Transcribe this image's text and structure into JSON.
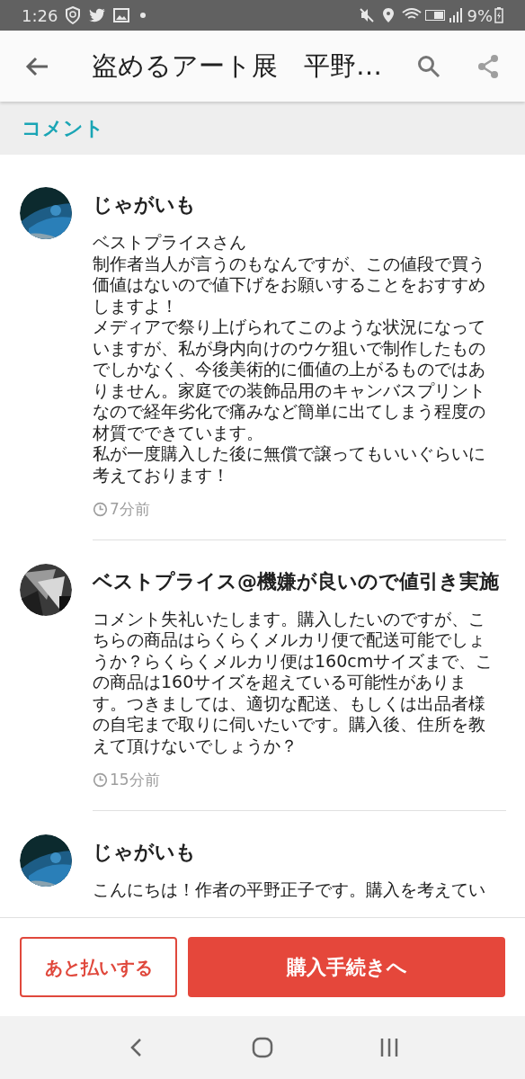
{
  "status_bar": {
    "time": "1:26",
    "battery": "9%"
  },
  "app_bar": {
    "title": "盗めるアート展　平野…"
  },
  "section": {
    "title": "コメント"
  },
  "comments": [
    {
      "author": "じゃがいも",
      "paragraphs": [
        "ベストプライスさん",
        "制作者当人が言うのもなんですが、この値段で買う価値はないので値下げをお願いすることをおすすめしますよ！",
        "メディアで祭り上げられてこのような状況になっていますが、私が身内向けのウケ狙いで制作したものでしかなく、今後美術的に価値の上がるものではありません。家庭での装飾品用のキャンバスプリントなので経年劣化で痛みなど簡単に出てしまう程度の材質でできています。",
        "私が一度購入した後に無償で譲ってもいいぐらいに考えております！"
      ],
      "time": "7分前"
    },
    {
      "author": "ベストプライス@機嫌が良いので値引き実施",
      "paragraphs": [
        "コメント失礼いたします。購入したいのですが、こちらの商品はらくらくメルカリ便で配送可能でしょうか？らくらくメルカリ便は160cmサイズまで、この商品は160サイズを超えている可能性があります。つきましては、適切な配送、もしくは出品者様の自宅まで取りに伺いたいです。購入後、住所を教えて頂けないでしょうか？"
      ],
      "time": "15分前"
    },
    {
      "author": "じゃがいも",
      "paragraphs": [
        "こんにちは！作者の平野正子です。購入を考えてい"
      ]
    }
  ],
  "buttons": {
    "secondary": "あと払いする",
    "primary": "購入手続きへ"
  }
}
